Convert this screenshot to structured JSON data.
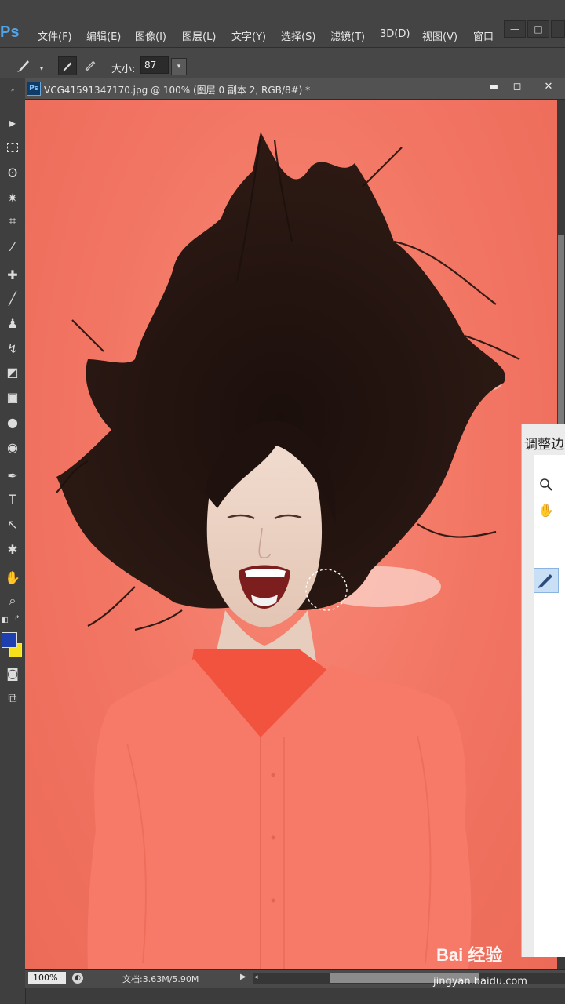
{
  "app": {
    "logo": "Ps"
  },
  "menu": [
    "文件(F)",
    "编辑(E)",
    "图像(I)",
    "图层(L)",
    "文字(Y)",
    "选择(S)",
    "滤镜(T)",
    "3D(D)",
    "视图(V)",
    "窗口"
  ],
  "options_bar": {
    "size_label": "大小:",
    "size_value": "87"
  },
  "document": {
    "title": "VCG41591347170.jpg @ 100% (图层 0 副本 2, RGB/8#) *"
  },
  "panel": {
    "title": "调整边"
  },
  "status": {
    "zoom": "100%",
    "doc_info": "文档:3.63M/5.90M"
  },
  "watermark": {
    "logo": "Bai 经验",
    "url": "jingyan.baidu.com"
  },
  "colors": {
    "foreground": "#1e3fb0",
    "background": "#f5e21a",
    "canvas_bg": "#f27462",
    "shirt": "#f77a68"
  }
}
